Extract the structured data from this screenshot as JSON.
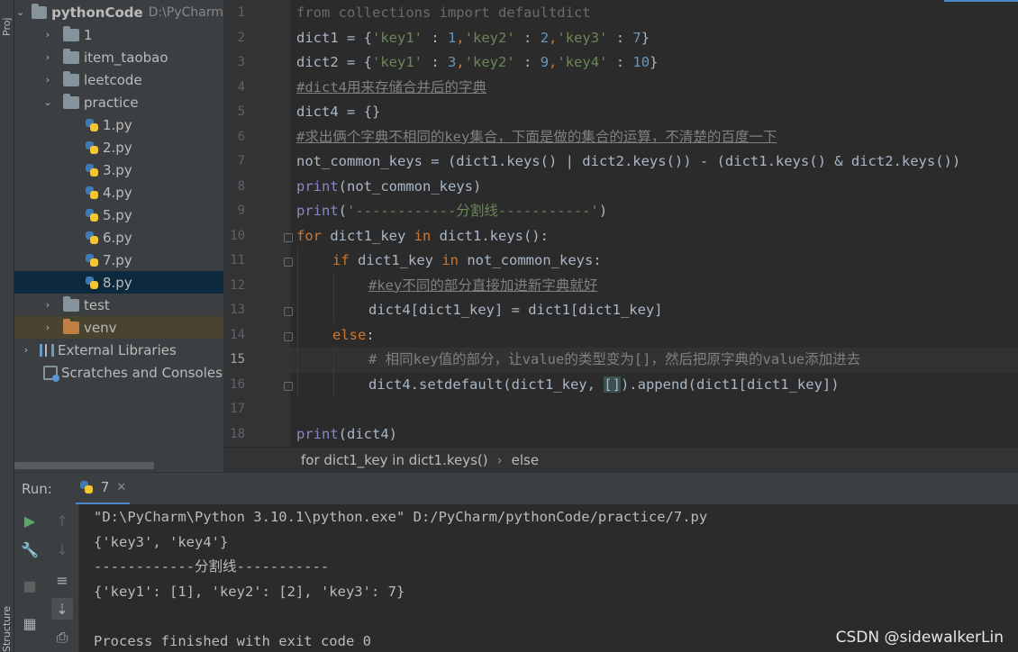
{
  "side_labels": {
    "project": "Proj",
    "structure": "Structure"
  },
  "project_tree": {
    "root": {
      "name": "pythonCode",
      "path": "D:\\PyCharm"
    },
    "items": [
      {
        "label": "1"
      },
      {
        "label": "item_taobao"
      },
      {
        "label": "leetcode"
      },
      {
        "label": "practice"
      },
      {
        "label": "1.py"
      },
      {
        "label": "2.py"
      },
      {
        "label": "3.py"
      },
      {
        "label": "4.py"
      },
      {
        "label": "5.py"
      },
      {
        "label": "6.py"
      },
      {
        "label": "7.py"
      },
      {
        "label": "8.py"
      },
      {
        "label": "test"
      },
      {
        "label": "venv"
      },
      {
        "label": "External Libraries"
      },
      {
        "label": "Scratches and Consoles"
      }
    ],
    "selected": "8.py"
  },
  "editor": {
    "current_line": "15",
    "line_numbers": [
      "1",
      "2",
      "3",
      "4",
      "5",
      "6",
      "7",
      "8",
      "9",
      "10",
      "11",
      "12",
      "13",
      "14",
      "15",
      "16",
      "17",
      "18"
    ],
    "t": {
      "l1": "from collections import defaultdict",
      "l2a": "dict1 = {",
      "l2b": "'key1'",
      "l2c": " : ",
      "l2d": "1",
      "l2e": ",",
      "l2f": "'key2'",
      "l2g": " : ",
      "l2h": "2",
      "l2i": ",",
      "l2j": "'key3'",
      "l2k": " : ",
      "l2l": "7",
      "l2m": "}",
      "l3a": "dict2 = {",
      "l3b": "'key1'",
      "l3c": " : ",
      "l3d": "3",
      "l3e": ",",
      "l3f": "'key2'",
      "l3g": " : ",
      "l3h": "9",
      "l3i": ",",
      "l3j": "'key4'",
      "l3k": " : ",
      "l3l": "10",
      "l3m": "}",
      "l4": "#dict4用来存储合并后的字典",
      "l5": "dict4 = {}",
      "l6": "#求出俩个字典不相同的key集合，下面是做的集合的运算，不清楚的百度一下",
      "l7": "not_common_keys = (dict1.keys() | dict2.keys()) - (dict1.keys() & dict2.keys())",
      "l8a": "print",
      "l8b": "(not_common_keys)",
      "l9a": "print",
      "l9b": "(",
      "l9c": "'------------分割线-----------'",
      "l9d": ")",
      "l10a": "for",
      "l10b": " dict1_key ",
      "l10c": "in",
      "l10d": " dict1.keys():",
      "l11a": "if",
      "l11b": " dict1_key ",
      "l11c": "in",
      "l11d": " not_common_keys:",
      "l12": "#key不同的部分直接加进新字典就好",
      "l13": "dict4[dict1_key] = dict1[dict1_key]",
      "l14a": "else",
      "l14b": ":",
      "l15": "# 相同key值的部分，让value的类型变为[]，然后把原字典的value添加进去",
      "l16a": "dict4.setdefault(dict1_key, ",
      "l16b": "[]",
      "l16c": ").append(dict1[dict1_key])",
      "l18a": "print",
      "l18b": "(dict4)"
    }
  },
  "breadcrumb": {
    "items": [
      "for dict1_key in dict1.keys()",
      "else"
    ],
    "separator": "›"
  },
  "run_panel": {
    "label": "Run:",
    "tab_name": "7",
    "output": [
      "\"D:\\PyCharm\\Python 3.10.1\\python.exe\" D:/PyCharm/pythonCode/practice/7.py",
      "{'key3', 'key4'}",
      "------------分割线-----------",
      "{'key1': [1], 'key2': [2], 'key3': 7}",
      "",
      "Process finished with exit code 0"
    ]
  },
  "watermark": "CSDN @sidewalkerLin",
  "colors": {
    "background": "#2b2b2b",
    "panel": "#3c3f41",
    "keyword": "#cc7832",
    "string": "#6a8759",
    "number": "#6897bb",
    "builtin": "#8888c6",
    "comment": "#808080",
    "selection": "#0d293e"
  },
  "icons": {
    "run": "play-icon",
    "settings": "wrench-icon",
    "stop": "stop-icon",
    "layout": "layout-icon",
    "up": "arrow-up-icon",
    "down": "arrow-down-icon",
    "wrap": "soft-wrap-icon",
    "scroll": "scroll-to-end-icon",
    "print": "print-icon"
  }
}
